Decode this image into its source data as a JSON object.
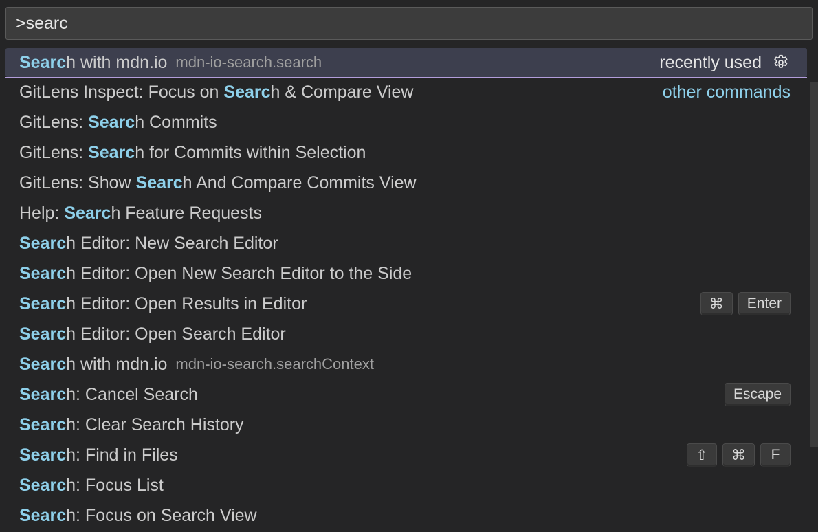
{
  "search": {
    "value": ">searc",
    "placeholder": ""
  },
  "colors": {
    "highlight": "#8ed0ea",
    "selection": "#3d3f4e",
    "accent_line": "#b39ddb"
  },
  "items": [
    {
      "pre": "",
      "hl": "Searc",
      "post": "h with mdn.io",
      "desc": "mdn-io-search.search",
      "meta": "recently used",
      "meta_icon": "gear-icon",
      "keys": []
    },
    {
      "pre": "GitLens Inspect: Focus on ",
      "hl": "Searc",
      "post": "h & Compare View",
      "desc": "",
      "meta": "other commands",
      "keys": []
    },
    {
      "pre": "GitLens: ",
      "hl": "Searc",
      "post": "h Commits",
      "desc": "",
      "meta": "",
      "keys": []
    },
    {
      "pre": "GitLens: ",
      "hl": "Searc",
      "post": "h for Commits within Selection",
      "desc": "",
      "meta": "",
      "keys": []
    },
    {
      "pre": "GitLens: Show ",
      "hl": "Searc",
      "post": "h And Compare Commits View",
      "desc": "",
      "meta": "",
      "keys": []
    },
    {
      "pre": "Help: ",
      "hl": "Searc",
      "post": "h Feature Requests",
      "desc": "",
      "meta": "",
      "keys": []
    },
    {
      "pre": "",
      "hl": "Searc",
      "post": "h Editor: New Search Editor",
      "desc": "",
      "meta": "",
      "keys": []
    },
    {
      "pre": "",
      "hl": "Searc",
      "post": "h Editor: Open New Search Editor to the Side",
      "desc": "",
      "meta": "",
      "keys": []
    },
    {
      "pre": "",
      "hl": "Searc",
      "post": "h Editor: Open Results in Editor",
      "desc": "",
      "meta": "",
      "keys": [
        "⌘",
        "Enter"
      ]
    },
    {
      "pre": "",
      "hl": "Searc",
      "post": "h Editor: Open Search Editor",
      "desc": "",
      "meta": "",
      "keys": []
    },
    {
      "pre": "",
      "hl": "Searc",
      "post": "h with mdn.io",
      "desc": "mdn-io-search.searchContext",
      "meta": "",
      "keys": []
    },
    {
      "pre": "",
      "hl": "Searc",
      "post": "h: Cancel Search",
      "desc": "",
      "meta": "",
      "keys": [
        "Escape"
      ]
    },
    {
      "pre": "",
      "hl": "Searc",
      "post": "h: Clear Search History",
      "desc": "",
      "meta": "",
      "keys": []
    },
    {
      "pre": "",
      "hl": "Searc",
      "post": "h: Find in Files",
      "desc": "",
      "meta": "",
      "keys": [
        "⇧",
        "⌘",
        "F"
      ]
    },
    {
      "pre": "",
      "hl": "Searc",
      "post": "h: Focus List",
      "desc": "",
      "meta": "",
      "keys": []
    },
    {
      "pre": "",
      "hl": "Searc",
      "post": "h: Focus on Search View",
      "desc": "",
      "meta": "",
      "keys": []
    }
  ]
}
